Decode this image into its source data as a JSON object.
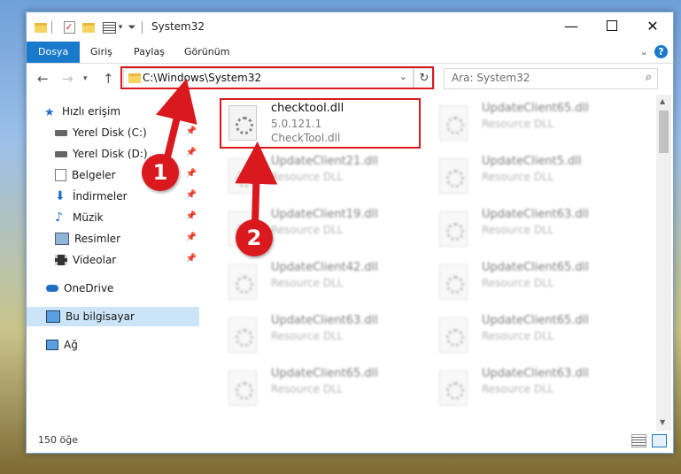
{
  "window": {
    "title": "System32"
  },
  "ribbon": {
    "tabs": [
      "Dosya",
      "Giriş",
      "Paylaş",
      "Görünüm"
    ],
    "help": "?"
  },
  "address": {
    "path": "C:\\Windows\\System32"
  },
  "search": {
    "placeholder": "Ara: System32"
  },
  "sidebar": {
    "items": [
      {
        "label": "Hızlı erişim"
      },
      {
        "label": "Yerel Disk (C:)"
      },
      {
        "label": "Yerel Disk (D:)"
      },
      {
        "label": "Belgeler"
      },
      {
        "label": "İndirmeler"
      },
      {
        "label": "Müzik"
      },
      {
        "label": "Resimler"
      },
      {
        "label": "Videolar"
      },
      {
        "label": "OneDrive"
      },
      {
        "label": "Bu bilgisayar"
      },
      {
        "label": "Ağ"
      }
    ]
  },
  "files": [
    {
      "name": "checktool.dll",
      "version": "5.0.121.1",
      "desc": "CheckTool.dll"
    },
    {
      "name": "UpdateClient65.dll",
      "desc": "Resource DLL"
    },
    {
      "name": "UpdateClient21.dll",
      "desc": "Resource DLL"
    },
    {
      "name": "UpdateClient5.dll",
      "desc": "Resource DLL"
    },
    {
      "name": "UpdateClient19.dll",
      "desc": "Resource DLL"
    },
    {
      "name": "UpdateClient63.dll",
      "desc": "Resource DLL"
    },
    {
      "name": "UpdateClient42.dll",
      "desc": "Resource DLL"
    },
    {
      "name": "UpdateClient65.dll",
      "desc": "Resource DLL"
    },
    {
      "name": "UpdateClient63.dll",
      "desc": "Resource DLL"
    },
    {
      "name": "UpdateClient65.dll",
      "desc": "Resource DLL"
    },
    {
      "name": "UpdateClient65.dll",
      "desc": "Resource DLL"
    },
    {
      "name": "UpdateClient63.dll",
      "desc": "Resource DLL"
    }
  ],
  "status": {
    "count": "150 öğe"
  },
  "markers": [
    "1",
    "2"
  ],
  "colors": {
    "accent": "#1979ca",
    "highlight": "#d9191e",
    "selection": "#cce4f7"
  }
}
